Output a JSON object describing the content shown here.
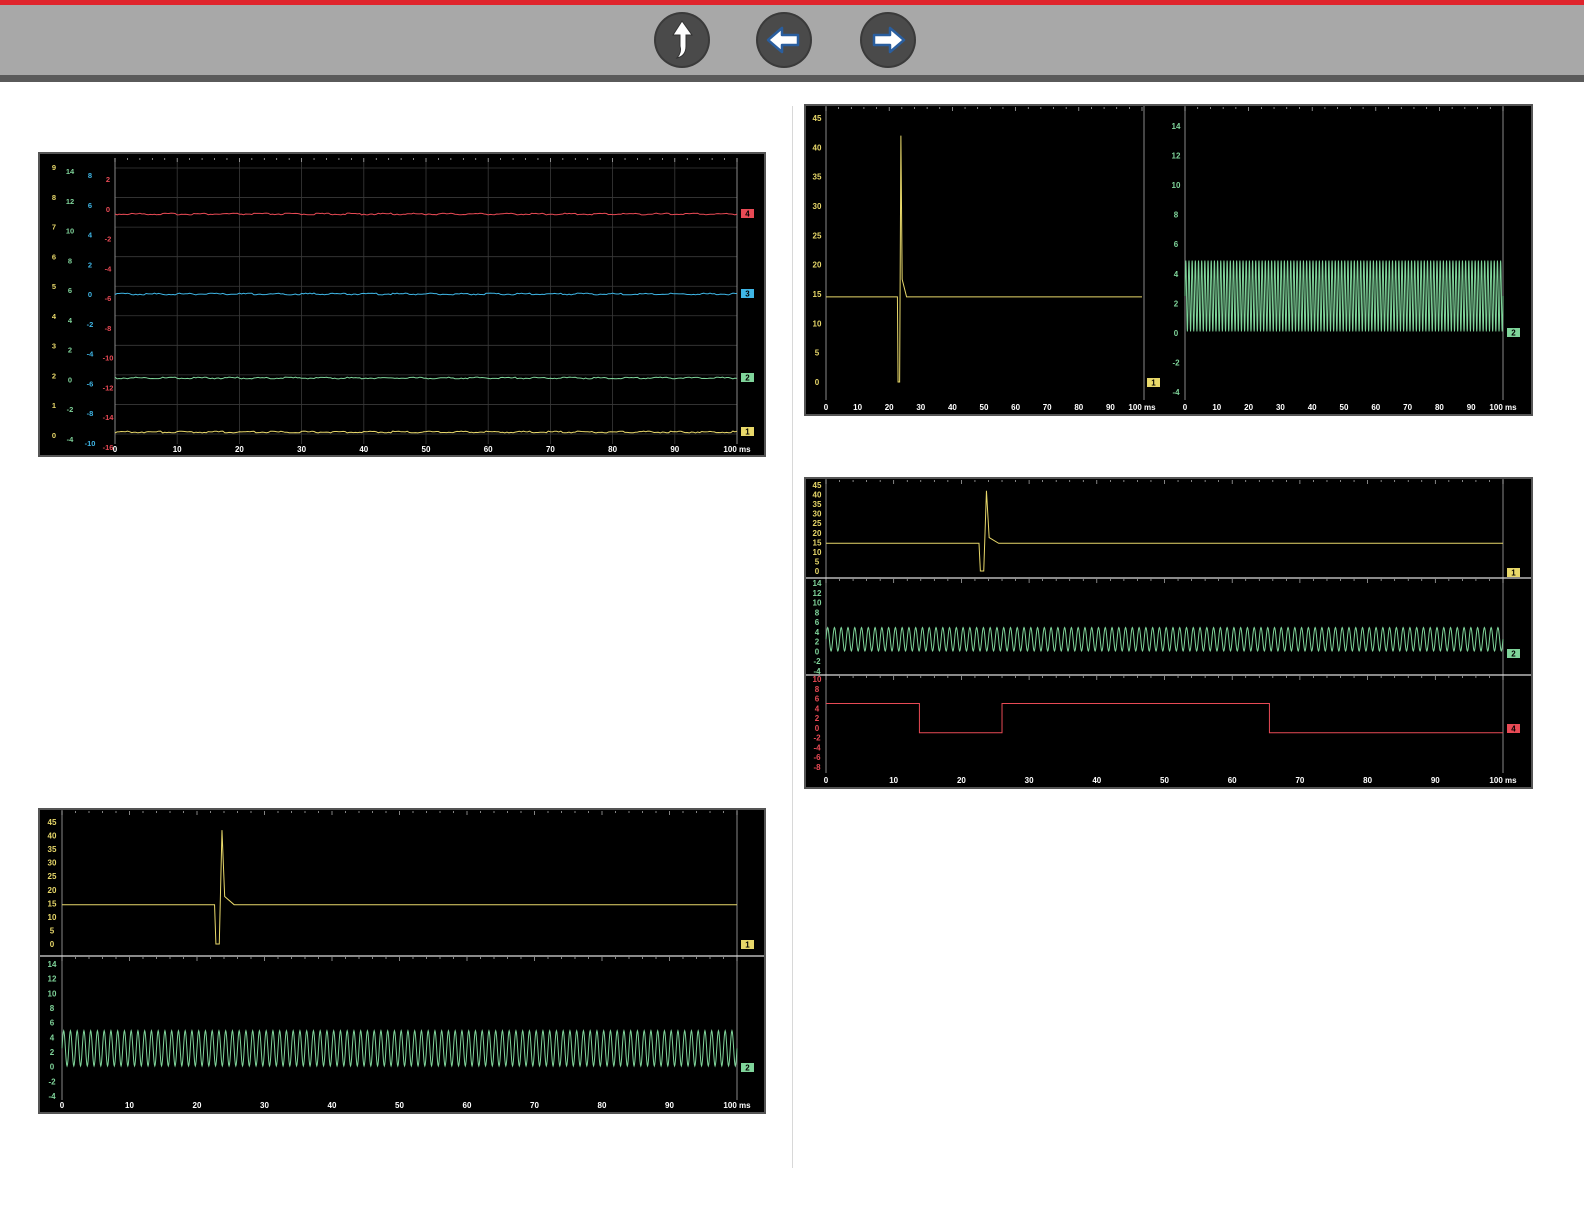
{
  "nav": {
    "up_label": "Up",
    "back_label": "Back",
    "forward_label": "Forward"
  },
  "colors": {
    "ch1": "#e8d86a",
    "ch2": "#7fd49a",
    "ch3": "#3fb6e6",
    "ch4": "#e84a55",
    "brand_red": "#e0242c"
  },
  "chart_data": [
    {
      "id": "scope-four-trace",
      "type": "line",
      "x_unit": "ms",
      "x_ticks": [
        "0",
        "10",
        "20",
        "30",
        "40",
        "50",
        "60",
        "70",
        "80",
        "90",
        "100 ms"
      ],
      "grid": true,
      "axes": [
        {
          "color": "ch1",
          "labels": [
            "9",
            "8",
            "7",
            "6",
            "5",
            "4",
            "3",
            "2",
            "1",
            "0"
          ]
        },
        {
          "color": "ch2",
          "labels": [
            "14",
            "12",
            "10",
            "8",
            "6",
            "4",
            "2",
            "0",
            "-2",
            "-4"
          ]
        },
        {
          "color": "ch3",
          "labels": [
            "8",
            "6",
            "4",
            "2",
            "0",
            "-2",
            "-4",
            "-6",
            "-8",
            "-10"
          ]
        },
        {
          "color": "ch4",
          "labels": [
            "2",
            "0",
            "-2",
            "-4",
            "-6",
            "-8",
            "-10",
            "-12",
            "-14",
            "-16"
          ]
        }
      ],
      "series": [
        {
          "channel": "4",
          "color": "ch4",
          "kind": "flat",
          "level": 0
        },
        {
          "channel": "3",
          "color": "ch3",
          "kind": "flat",
          "level": -5.5
        },
        {
          "channel": "2",
          "color": "ch2",
          "kind": "flat",
          "level": -10.8
        },
        {
          "channel": "1",
          "color": "ch1",
          "kind": "flat",
          "level": 0
        }
      ]
    },
    {
      "id": "scope-two-trace-stacked",
      "type": "line",
      "x_unit": "ms",
      "x_ticks": [
        "0",
        "10",
        "20",
        "30",
        "40",
        "50",
        "60",
        "70",
        "80",
        "90",
        "100 ms"
      ],
      "panes": [
        {
          "channel": "1",
          "color": "ch1",
          "ticks": [
            "45",
            "40",
            "35",
            "30",
            "25",
            "20",
            "15",
            "10",
            "5",
            "0"
          ],
          "ylim": [
            0,
            45
          ],
          "kind": "spike",
          "baseline": 14.5,
          "spike_at": 23,
          "spike_peak": 42,
          "dip": 0
        },
        {
          "channel": "2",
          "color": "ch2",
          "ticks": [
            "14",
            "12",
            "10",
            "8",
            "6",
            "4",
            "2",
            "0",
            "-2",
            "-4"
          ],
          "ylim": [
            -4,
            14
          ],
          "kind": "sine",
          "center": 2.5,
          "amplitude": 2.4,
          "cycles": 100
        }
      ]
    },
    {
      "id": "scope-side-by-side",
      "type": "line",
      "x_unit": "ms",
      "panes": [
        {
          "channel": "1",
          "color": "ch1",
          "ticks": [
            "45",
            "40",
            "35",
            "30",
            "25",
            "20",
            "15",
            "10",
            "5",
            "0"
          ],
          "ylim": [
            0,
            45
          ],
          "kind": "spike",
          "baseline": 14.5,
          "spike_at": 23,
          "spike_peak": 42,
          "dip": 0,
          "x_ticks": [
            "0",
            "10",
            "20",
            "30",
            "40",
            "50",
            "60",
            "70",
            "80",
            "90",
            "100 ms"
          ]
        },
        {
          "channel": "2",
          "color": "ch2",
          "ticks": [
            "14",
            "12",
            "10",
            "8",
            "6",
            "4",
            "2",
            "0",
            "-2",
            "-4"
          ],
          "ylim": [
            -4,
            14
          ],
          "kind": "sine",
          "center": 2.5,
          "amplitude": 2.4,
          "cycles": 100,
          "x_ticks": [
            "0",
            "10",
            "20",
            "30",
            "40",
            "50",
            "60",
            "70",
            "80",
            "90",
            "100 ms"
          ]
        }
      ]
    },
    {
      "id": "scope-three-trace-stacked",
      "type": "line",
      "x_unit": "ms",
      "x_ticks": [
        "0",
        "10",
        "20",
        "30",
        "40",
        "50",
        "60",
        "70",
        "80",
        "90",
        "100 ms"
      ],
      "panes": [
        {
          "channel": "1",
          "color": "ch1",
          "ticks": [
            "45",
            "40",
            "35",
            "30",
            "25",
            "20",
            "15",
            "10",
            "5",
            "0"
          ],
          "ylim": [
            0,
            45
          ],
          "kind": "spike",
          "baseline": 14.5,
          "spike_at": 23,
          "spike_peak": 42,
          "dip": 0
        },
        {
          "channel": "2",
          "color": "ch2",
          "ticks": [
            "14",
            "12",
            "10",
            "8",
            "6",
            "4",
            "2",
            "0",
            "-2",
            "-4"
          ],
          "ylim": [
            -4,
            14
          ],
          "kind": "sine",
          "center": 2.5,
          "amplitude": 2.4,
          "cycles": 100
        },
        {
          "channel": "4",
          "color": "ch4",
          "ticks": [
            "10",
            "8",
            "6",
            "4",
            "2",
            "0",
            "-2",
            "-4",
            "-6",
            "-8"
          ],
          "ylim": [
            -8,
            10
          ],
          "kind": "steps",
          "steps": [
            [
              0,
              5
            ],
            [
              13.8,
              -1
            ],
            [
              26,
              5
            ],
            [
              65.5,
              -1
            ],
            [
              100,
              -1
            ]
          ]
        }
      ]
    }
  ]
}
